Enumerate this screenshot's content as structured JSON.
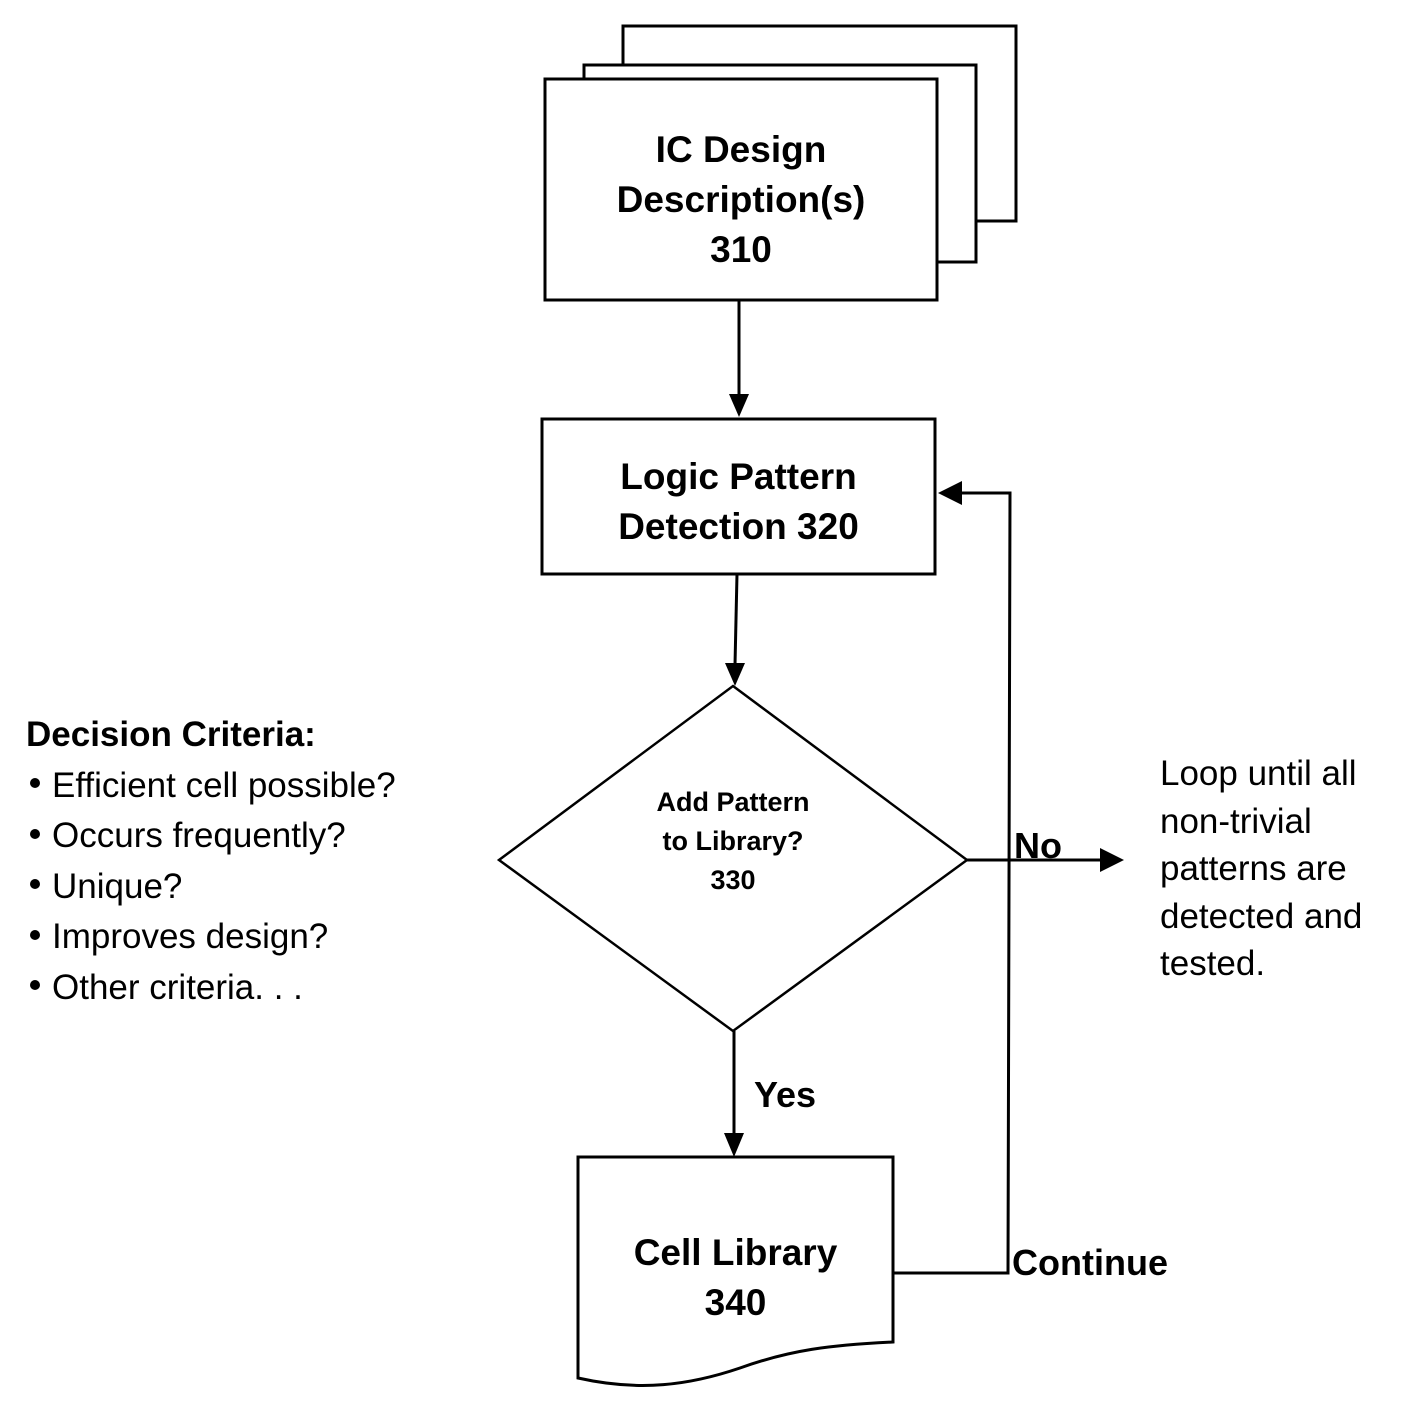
{
  "diagram": {
    "type": "flowchart",
    "nodes": {
      "ic_design": {
        "shape": "multi-document",
        "lines": [
          "IC Design",
          "Description(s)",
          "310"
        ]
      },
      "detection": {
        "shape": "process",
        "lines": [
          "Logic Pattern",
          "Detection 320"
        ]
      },
      "decision": {
        "shape": "decision",
        "lines": [
          "Add Pattern",
          "to Library?",
          "330"
        ]
      },
      "cell_library": {
        "shape": "document",
        "lines": [
          "Cell Library",
          "340"
        ]
      }
    },
    "edges": {
      "yes_label": "Yes",
      "no_label": "No",
      "continue_label": "Continue"
    },
    "criteria": {
      "title": "Decision Criteria:",
      "items": [
        "Efficient cell possible?",
        "Occurs frequently?",
        "Unique?",
        "Improves design?",
        "Other criteria. . ."
      ]
    },
    "loop_note": {
      "lines": [
        "Loop until all",
        "non-trivial",
        "patterns are",
        "detected and",
        "tested."
      ]
    }
  }
}
